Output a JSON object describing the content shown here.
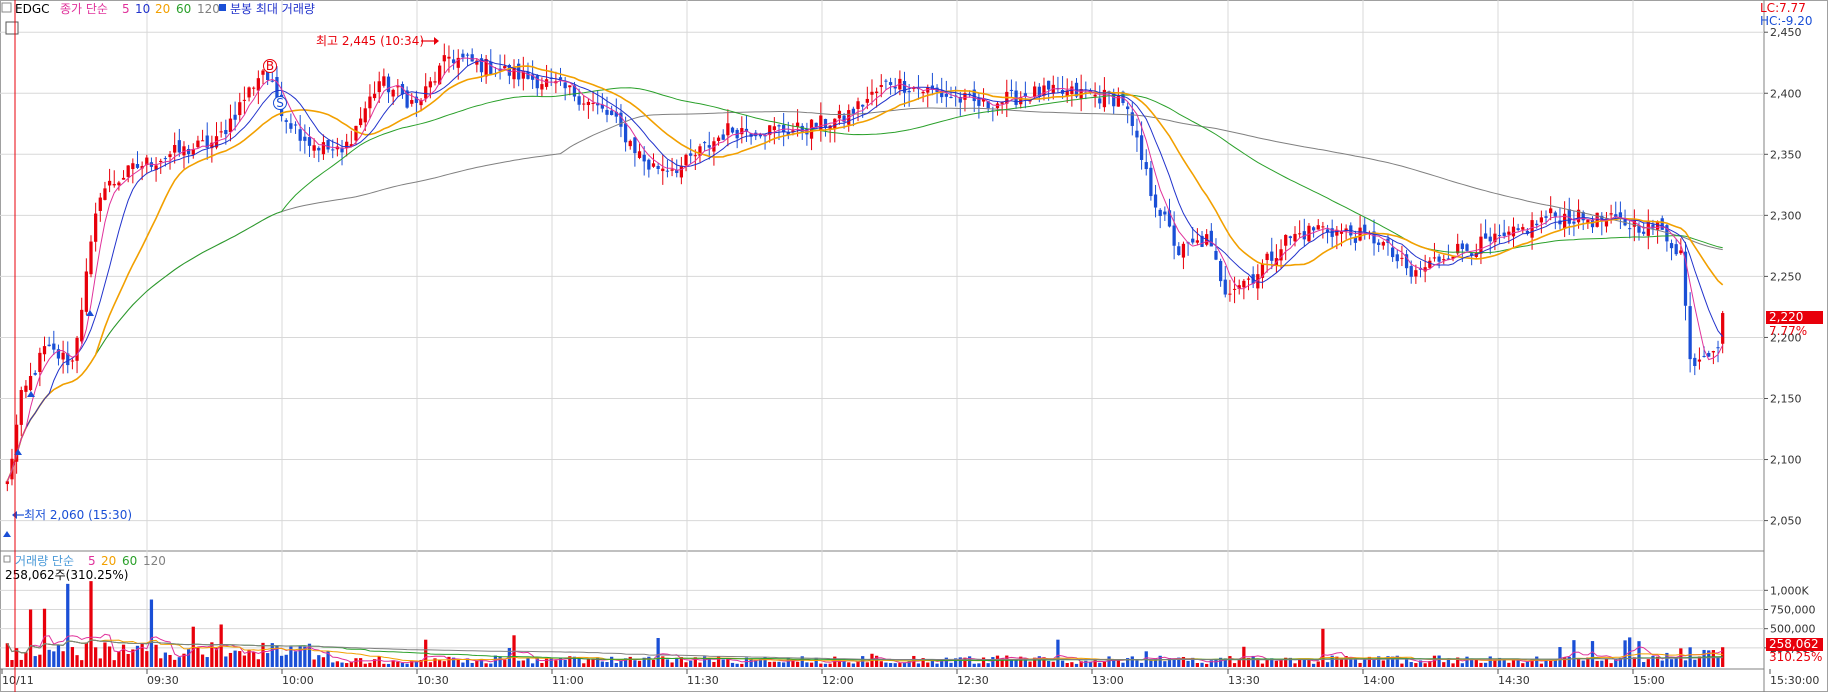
{
  "header": {
    "symbol": "EDGC",
    "price_ind_label": "종가 단순",
    "ma_values": [
      "5",
      "10",
      "20",
      "60",
      "120"
    ],
    "extra_label": "분봉 최대 거래량",
    "lc": "LC:7.77",
    "hc": "HC:-9.20"
  },
  "volume_header": {
    "label": "거래량 단순",
    "ma_values": [
      "5",
      "20",
      "60",
      "120"
    ],
    "value_text": "258,062주(310.25%)"
  },
  "annotations": {
    "high": "최고 2,445 (10:34)",
    "low": "최저 2,060 (15:30)",
    "buy_marker": "B",
    "sell_marker": "S",
    "last_price_box": "2,220",
    "last_pct": "7.77%",
    "last_vol_box": "258,062",
    "last_vol_pct": "310.25%"
  },
  "colors": {
    "up": "#e8000b",
    "down": "#1a4fd6",
    "ma5": "#e0329b",
    "ma10": "#2233cc",
    "ma20": "#f2a000",
    "ma60": "#2aa02a",
    "ma120": "#808080",
    "grid": "#d8d8d8"
  },
  "chart_data": [
    {
      "type": "candlestick",
      "title": "EDGC",
      "ylim": [
        2030,
        2460
      ],
      "y_ticks": [
        "2,450",
        "2,400",
        "2,350",
        "2,300",
        "2,250",
        "2,200",
        "2,150",
        "2,100",
        "2,050"
      ],
      "x_labels": [
        "10/11",
        "09:30",
        "10:00",
        "10:30",
        "11:00",
        "11:30",
        "12:00",
        "12:30",
        "13:00",
        "13:30",
        "14:00",
        "14:30",
        "15:00",
        "15:30:00"
      ],
      "close_keypoints": [
        {
          "t": 0,
          "v": 2080
        },
        {
          "t": 3,
          "v": 2150
        },
        {
          "t": 8,
          "v": 2190
        },
        {
          "t": 14,
          "v": 2180
        },
        {
          "t": 20,
          "v": 2320
        },
        {
          "t": 28,
          "v": 2340
        },
        {
          "t": 35,
          "v": 2350
        },
        {
          "t": 45,
          "v": 2360
        },
        {
          "t": 55,
          "v": 2420
        },
        {
          "t": 60,
          "v": 2380
        },
        {
          "t": 65,
          "v": 2360
        },
        {
          "t": 72,
          "v": 2350
        },
        {
          "t": 80,
          "v": 2410
        },
        {
          "t": 88,
          "v": 2390
        },
        {
          "t": 95,
          "v": 2430
        },
        {
          "t": 105,
          "v": 2420
        },
        {
          "t": 115,
          "v": 2410
        },
        {
          "t": 122,
          "v": 2400
        },
        {
          "t": 130,
          "v": 2380
        },
        {
          "t": 138,
          "v": 2340
        },
        {
          "t": 145,
          "v": 2340
        },
        {
          "t": 155,
          "v": 2370
        },
        {
          "t": 170,
          "v": 2370
        },
        {
          "t": 180,
          "v": 2380
        },
        {
          "t": 190,
          "v": 2410
        },
        {
          "t": 200,
          "v": 2400
        },
        {
          "t": 210,
          "v": 2390
        },
        {
          "t": 220,
          "v": 2400
        },
        {
          "t": 230,
          "v": 2400
        },
        {
          "t": 240,
          "v": 2395
        },
        {
          "t": 246,
          "v": 2320
        },
        {
          "t": 252,
          "v": 2270
        },
        {
          "t": 258,
          "v": 2280
        },
        {
          "t": 262,
          "v": 2240
        },
        {
          "t": 268,
          "v": 2250
        },
        {
          "t": 275,
          "v": 2280
        },
        {
          "t": 282,
          "v": 2290
        },
        {
          "t": 295,
          "v": 2280
        },
        {
          "t": 302,
          "v": 2250
        },
        {
          "t": 310,
          "v": 2270
        },
        {
          "t": 322,
          "v": 2280
        },
        {
          "t": 332,
          "v": 2300
        },
        {
          "t": 345,
          "v": 2295
        },
        {
          "t": 355,
          "v": 2290
        },
        {
          "t": 360,
          "v": 2270
        },
        {
          "t": 362,
          "v": 2180
        },
        {
          "t": 366,
          "v": 2190
        },
        {
          "t": 369,
          "v": 2200
        }
      ],
      "n_bars": 370,
      "high": {
        "time": "10:34",
        "value": 2445
      },
      "low": {
        "time": "15:30",
        "value": 2060
      },
      "last": {
        "value": 2220,
        "change_pct": 7.77
      },
      "series": [
        {
          "name": "5"
        },
        {
          "name": "10"
        },
        {
          "name": "20"
        },
        {
          "name": "60"
        },
        {
          "name": "120"
        }
      ]
    },
    {
      "type": "bar",
      "title": "거래량",
      "ylim": [
        0,
        1200000
      ],
      "y_ticks": [
        "1,000K",
        "750,000",
        "500,000",
        "250,000"
      ],
      "last": {
        "value": 258062,
        "ratio_pct": 310.25
      },
      "series": [
        {
          "name": "5"
        },
        {
          "name": "20"
        },
        {
          "name": "60"
        },
        {
          "name": "120"
        }
      ]
    }
  ]
}
